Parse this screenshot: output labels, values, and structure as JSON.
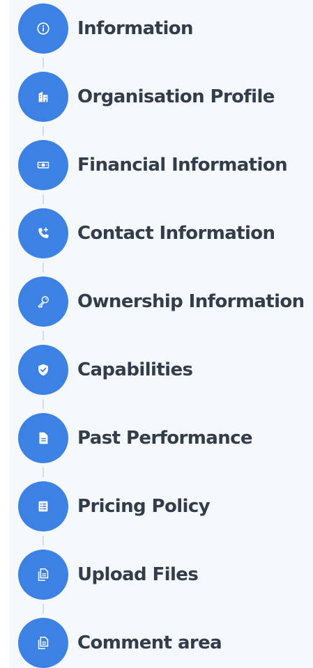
{
  "stepper": {
    "steps": [
      {
        "label": "Information",
        "icon": "info-icon"
      },
      {
        "label": "Organisation Profile",
        "icon": "building-icon"
      },
      {
        "label": "Financial Information",
        "icon": "banknote-icon"
      },
      {
        "label": "Contact Information",
        "icon": "phone-plus-icon"
      },
      {
        "label": "Ownership Information",
        "icon": "key-icon"
      },
      {
        "label": "Capabilities",
        "icon": "shield-check-icon"
      },
      {
        "label": "Past Performance",
        "icon": "document-icon"
      },
      {
        "label": "Pricing Policy",
        "icon": "list-icon"
      },
      {
        "label": "Upload Files",
        "icon": "files-icon"
      },
      {
        "label": "Comment area",
        "icon": "files-icon"
      }
    ]
  },
  "colors": {
    "accent": "#3b82e4",
    "label": "#333c4a",
    "connector": "#d7dce3",
    "panel": "#f5f8fc"
  }
}
